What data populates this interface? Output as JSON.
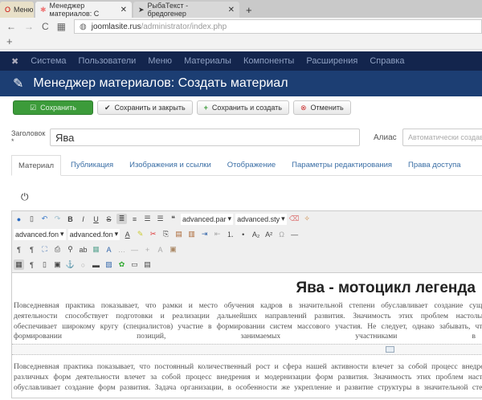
{
  "browser": {
    "menu_label": "Меню",
    "tabs": [
      {
        "title": "Менеджер материалов: С"
      },
      {
        "title": "РыбаТекст - бредогенер"
      }
    ],
    "new_tab": "+",
    "url_host": "joomlasite.rus",
    "url_path": "/administrator/index.php",
    "bookmark_add": "+"
  },
  "nav": {
    "items": [
      "Система",
      "Пользователи",
      "Меню",
      "Материалы",
      "Компоненты",
      "Расширения",
      "Справка"
    ]
  },
  "header": {
    "title": "Менеджер материалов: Создать материал"
  },
  "toolbar": {
    "save": "Сохранить",
    "save_close": "Сохранить и закрыть",
    "save_new": "Сохранить и создать",
    "cancel": "Отменить"
  },
  "form": {
    "title_label": "Заголовок *",
    "title_value": "Ява",
    "alias_label": "Алиас",
    "alias_placeholder": "Автоматически создав"
  },
  "tabs": [
    "Материал",
    "Публикация",
    "Изображения и ссылки",
    "Отображение",
    "Параметры редактирования",
    "Права доступа"
  ],
  "editor": {
    "paragraph_select": "advanced.par",
    "style_select": "advanced.sty",
    "font_select": "advanced.fon",
    "size_select": "advanced.fon",
    "heading": "Ява - мотоцикл легенда",
    "para1": [
      "Повседневная практика показывает, что рамки и место обучения кадров в значительной степени обуславливает создание существенных ф",
      "деятельности способствует подготовки и реализации дальнейших направлений развития. Значимость этих проблем настолько очевидна,",
      "обеспечивает широкому кругу (специалистов) участие в формировании систем массового участия. Не следует, однако забывать, что реализация"
    ],
    "para1_last": [
      "формировании",
      "позиций,",
      "занимаемых",
      "участниками",
      "в"
    ],
    "para2": [
      "Повседневная практика показывает, что постоянный количественный рост и сфера нашей активности влечет за собой процесс внедрения и модер",
      "различных форм деятельности влечет за собой процесс внедрения и модернизации форм развития. Значимость этих проблем настолько очевид",
      "обуславливает создание форм развития. Задача организации, в особенности же укрепление и развитие структуры в значительной степени обуслав"
    ]
  }
}
